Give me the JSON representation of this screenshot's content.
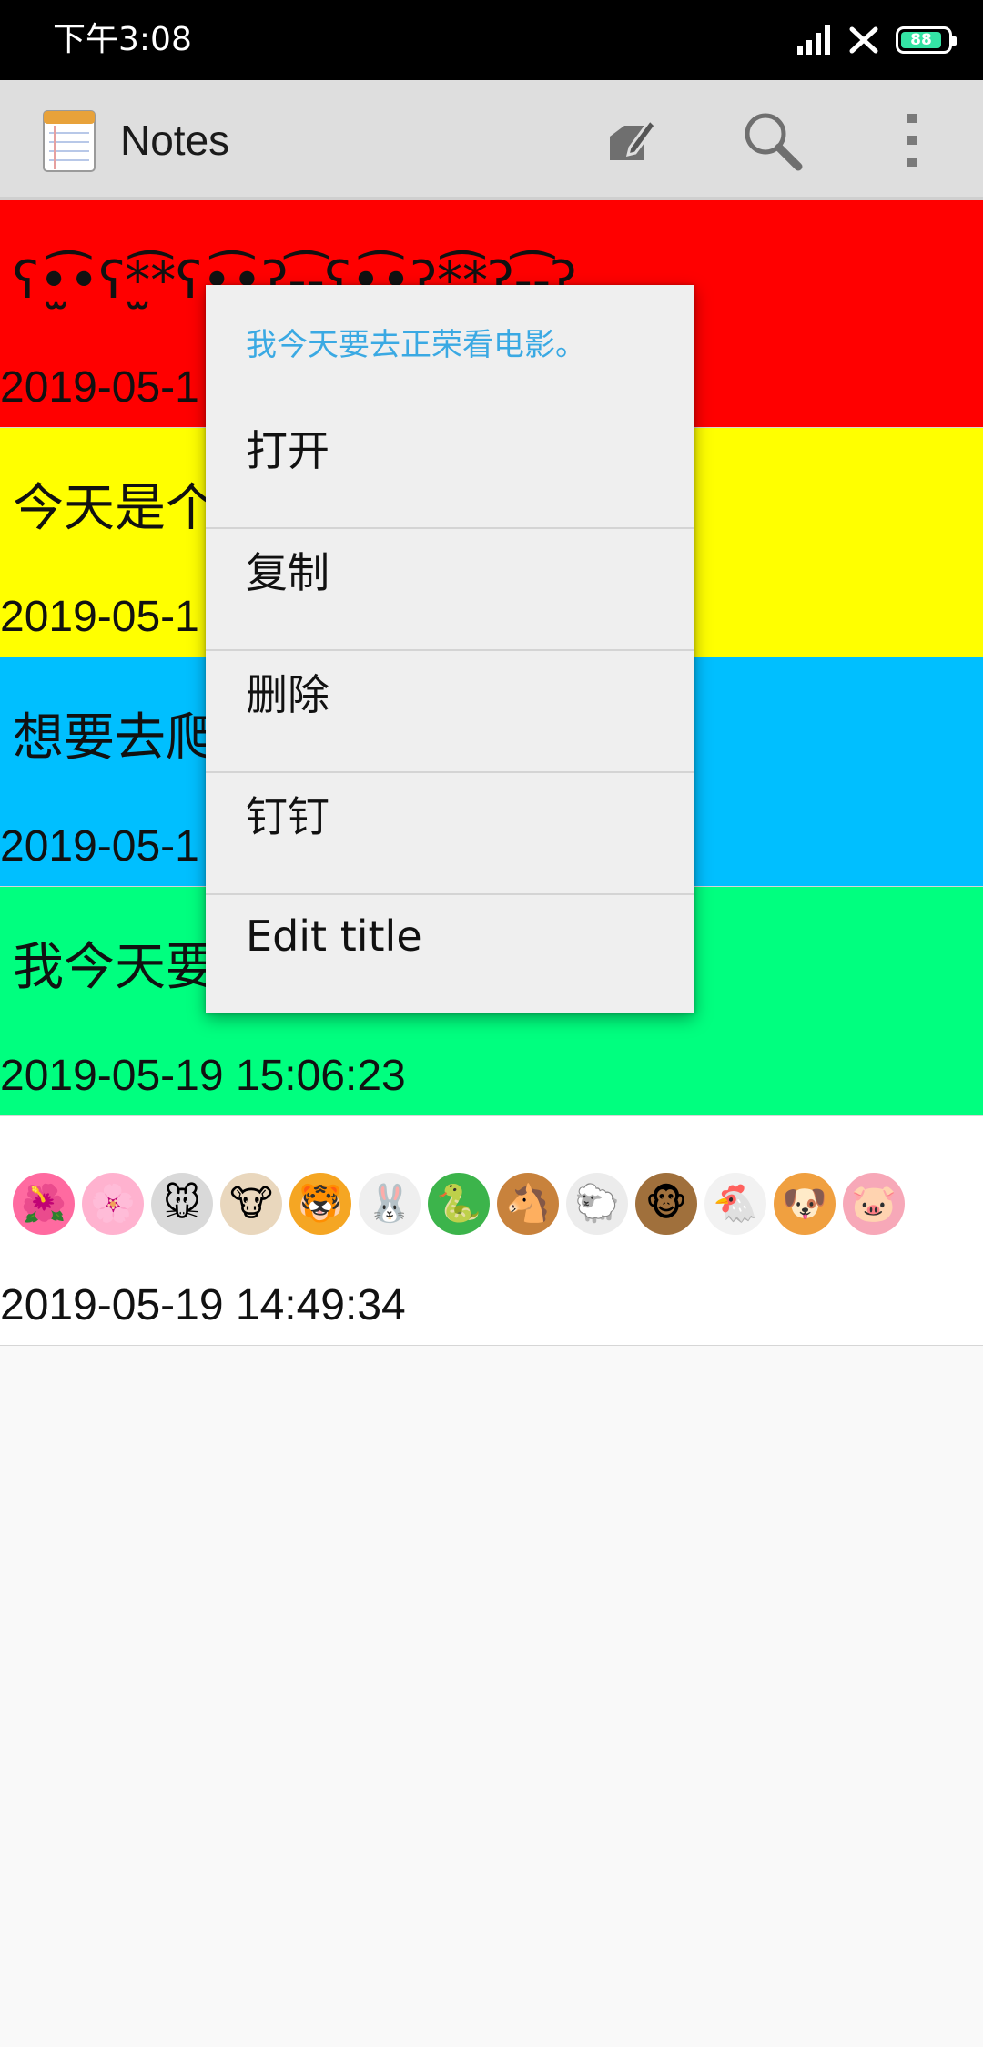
{
  "status_bar": {
    "time": "下午3:08",
    "battery": "88",
    "icons": [
      "signal-icon",
      "no-sim-icon",
      "battery-icon"
    ]
  },
  "app_bar": {
    "title": "Notes",
    "actions": [
      "new-note-icon",
      "search-icon",
      "more-options-icon"
    ]
  },
  "notes": [
    {
      "title": "ʕ•̫͡•ʕ*̫͡*ʕ•͓͡•ʔ-̫͡-ʕ•̫͡•ʔ*̫͡*ʔ-̫͡-ʔ",
      "date": "2019-05-1",
      "color": "#ff0000"
    },
    {
      "title": "今天是个",
      "date": "2019-05-1",
      "color": "#ffff00"
    },
    {
      "title": "想要去爬",
      "date": "2019-05-1",
      "color": "#00bfff"
    },
    {
      "title": "我今天要",
      "date": "2019-05-19 15:06:23",
      "color": "#00ff7f"
    },
    {
      "title": "",
      "date": "2019-05-19 14:49:34",
      "color": "#ffffff",
      "emojis": [
        "🌺",
        "🌸",
        "🐭",
        "🐮",
        "🐯",
        "🐰",
        "🐍",
        "🐴",
        "🐑",
        "🐵",
        "🐔",
        "🐶",
        "🐷"
      ]
    }
  ],
  "context_menu": {
    "header": "我今天要去正荣看电影。",
    "items": [
      "打开",
      "复制",
      "删除",
      "钉钉",
      "Edit title"
    ]
  }
}
